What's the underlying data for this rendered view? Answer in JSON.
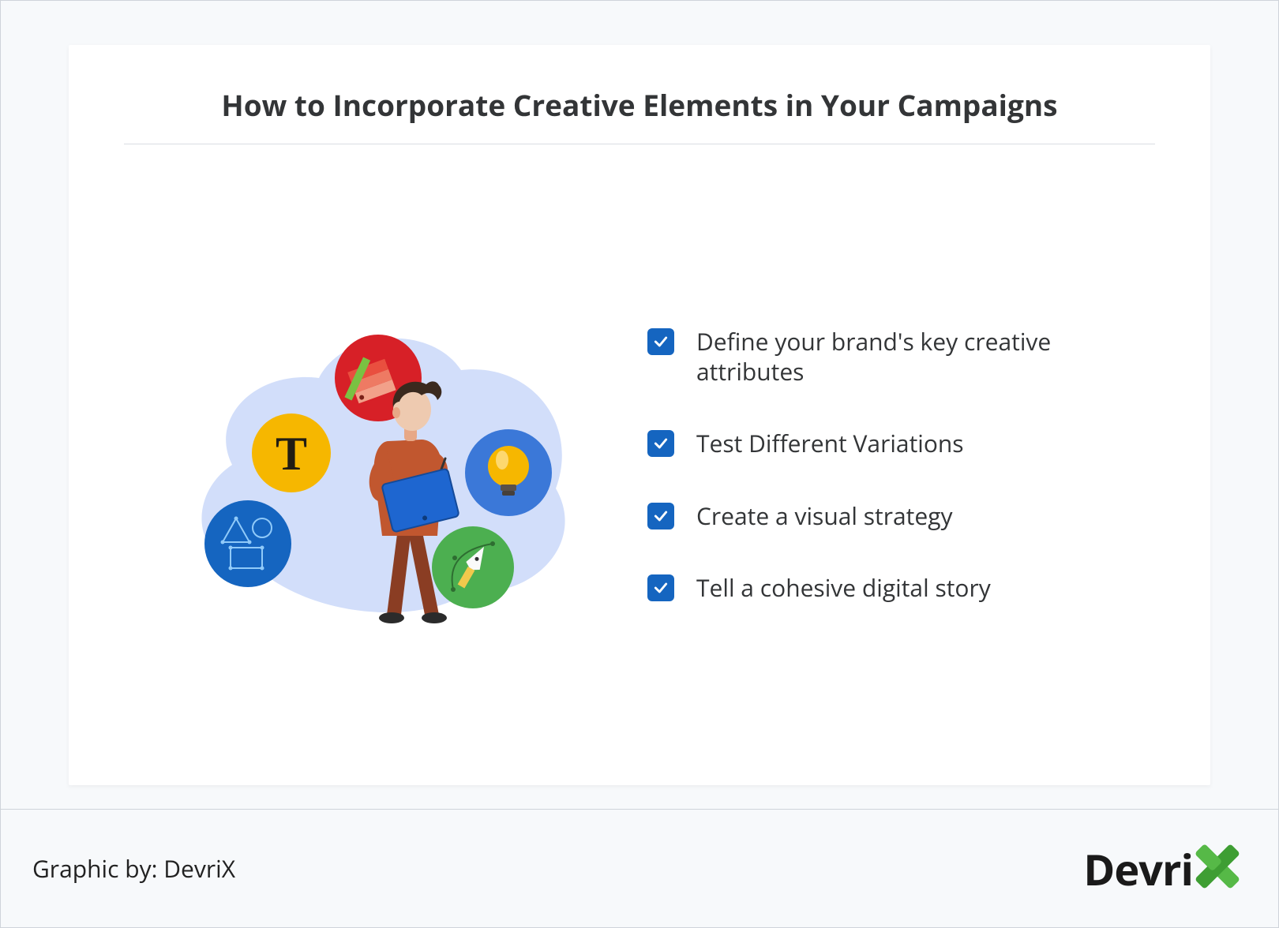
{
  "title": "How to Incorporate Creative Elements in Your Campaigns",
  "items": [
    {
      "label": "Define your brand's key creative attributes"
    },
    {
      "label": "Test Different Variations"
    },
    {
      "label": "Create a visual strategy"
    },
    {
      "label": "Tell a cohesive digital story"
    }
  ],
  "attribution": "Graphic by: DevriX",
  "brand": {
    "name": "DevriX",
    "text_part": "Devri"
  },
  "colors": {
    "checkbox_bg": "#1565c0",
    "accent_green": "#56b947",
    "page_bg": "#f7f9fb",
    "card_bg": "#ffffff"
  }
}
